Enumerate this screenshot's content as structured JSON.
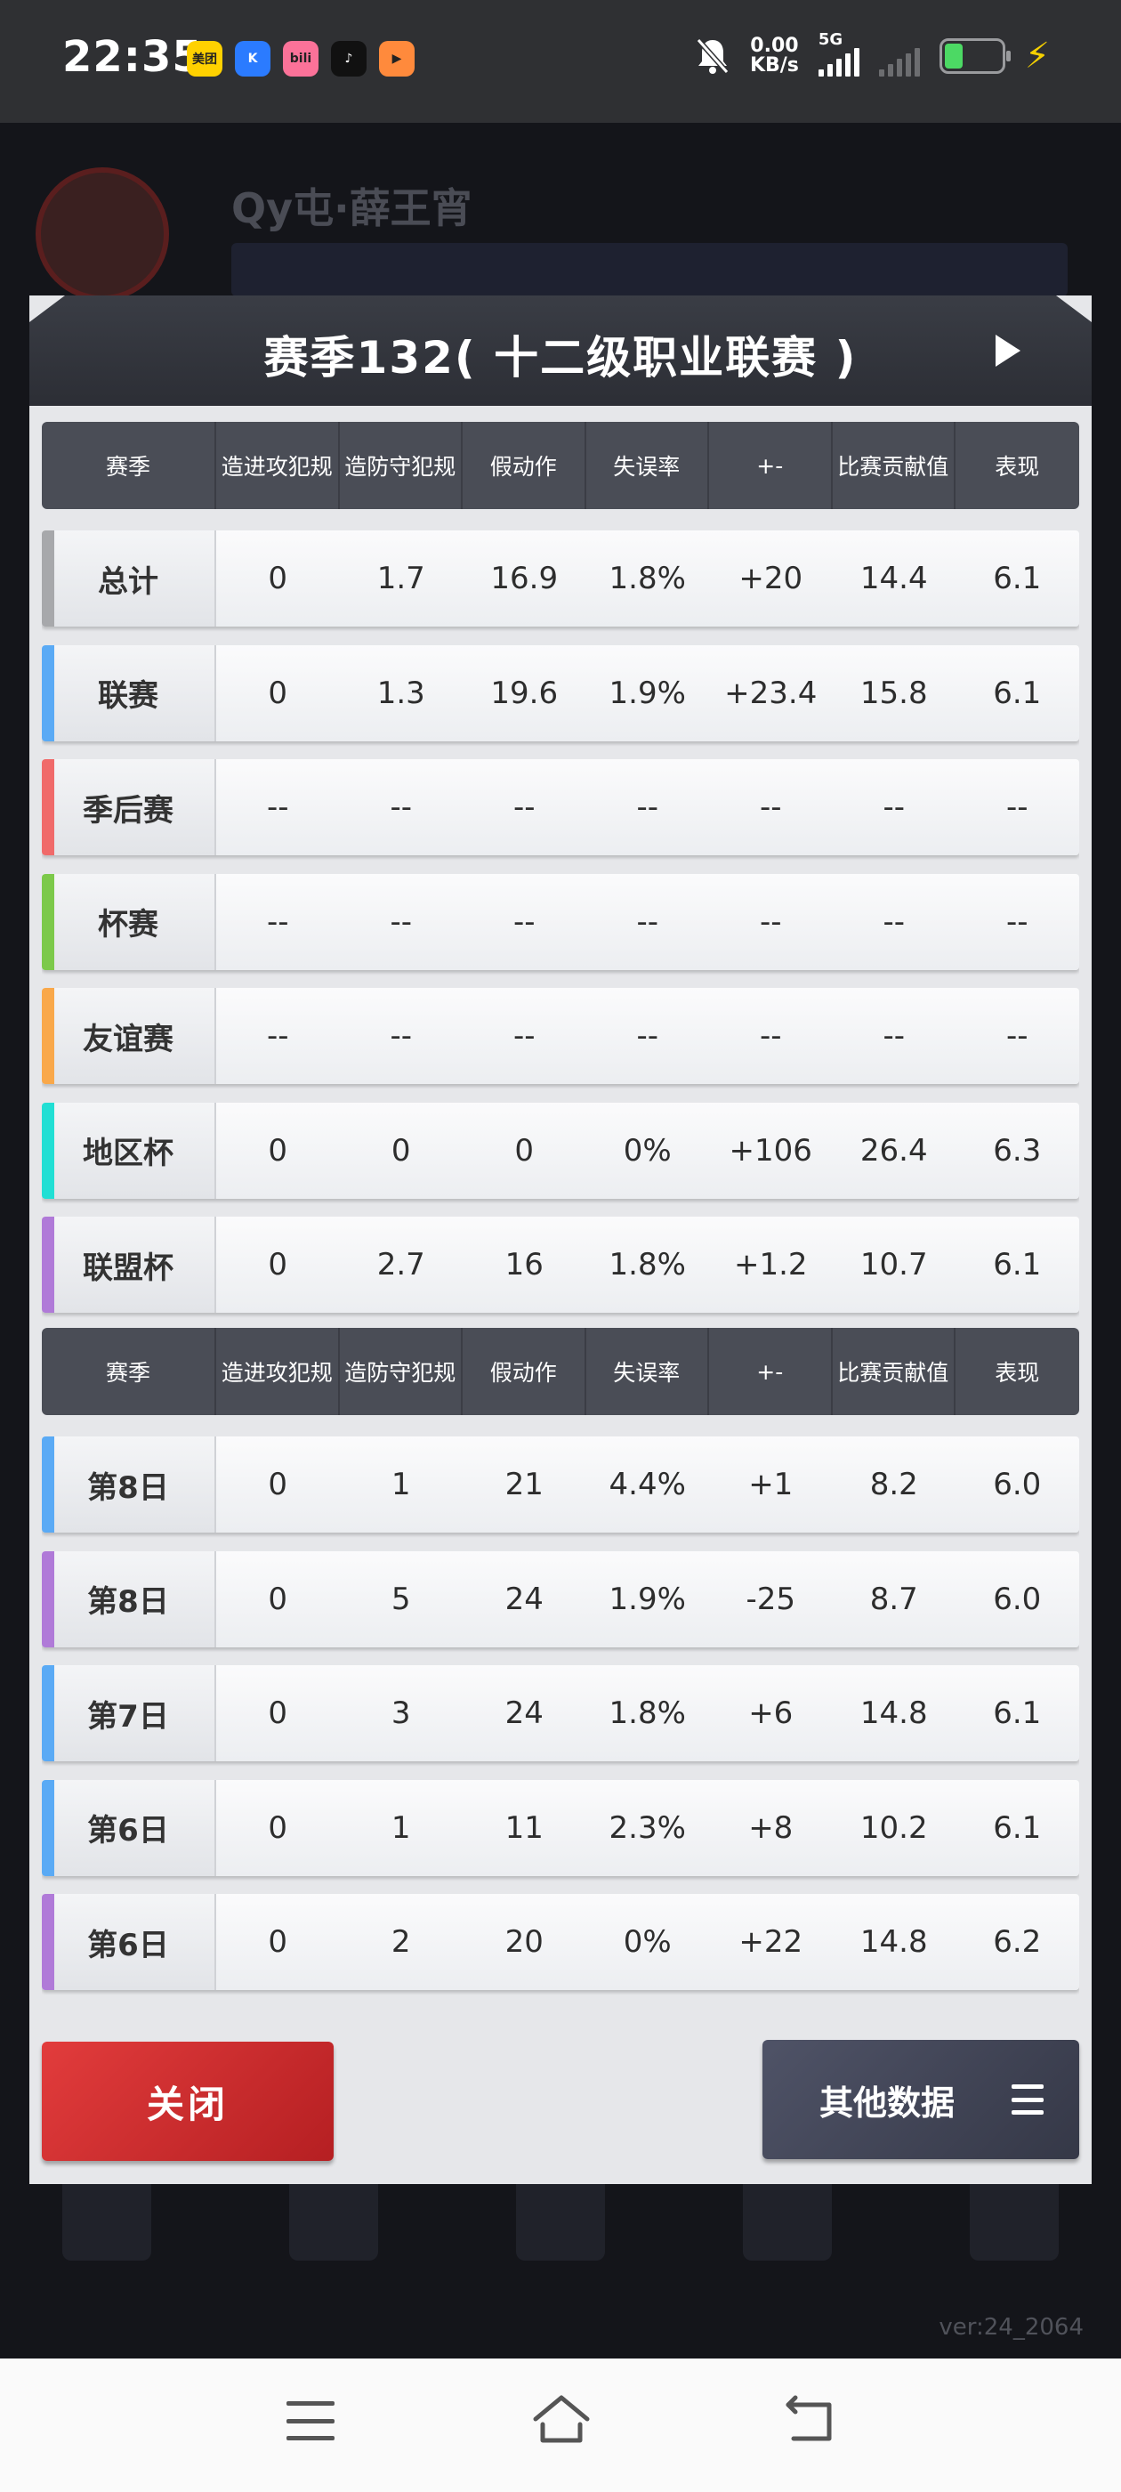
{
  "status_bar": {
    "time": "22:35",
    "apps": [
      {
        "label": "美团",
        "color": "#ffd100",
        "icon": "meituan-icon"
      },
      {
        "label": "K",
        "color": "#2b7bff",
        "icon": "kugou-icon"
      },
      {
        "label": "bili",
        "color": "#fb7299",
        "icon": "bilibili-icon"
      },
      {
        "label": "♪",
        "color": "#111111",
        "icon": "tiktok-icon"
      },
      {
        "label": "▶",
        "color": "#ff8a3c",
        "icon": "video-icon"
      }
    ],
    "speed_value": "0.00",
    "speed_unit": "KB/s",
    "network": "5G",
    "icons": [
      "mute-icon",
      "signal-icon",
      "battery-icon",
      "charging-icon"
    ]
  },
  "modal": {
    "title": "赛季132( 十二级职业联赛 )",
    "columns": [
      "赛季",
      "造进攻犯规",
      "造防守犯规",
      "假动作",
      "失误率",
      "+-",
      "比赛贡献值",
      "表现"
    ],
    "summary_rows": [
      {
        "label": "总计",
        "accent": "#a7a8ab",
        "values": [
          "0",
          "1.7",
          "16.9",
          "1.8%",
          "+20",
          "14.4",
          "6.1"
        ]
      },
      {
        "label": "联赛",
        "accent": "#5aaaf5",
        "values": [
          "0",
          "1.3",
          "19.6",
          "1.9%",
          "+23.4",
          "15.8",
          "6.1"
        ]
      },
      {
        "label": "季后赛",
        "accent": "#f06a6a",
        "values": [
          "--",
          "--",
          "--",
          "--",
          "--",
          "--",
          "--"
        ]
      },
      {
        "label": "杯赛",
        "accent": "#7cc94a",
        "values": [
          "--",
          "--",
          "--",
          "--",
          "--",
          "--",
          "--"
        ]
      },
      {
        "label": "友谊赛",
        "accent": "#f9a84a",
        "values": [
          "--",
          "--",
          "--",
          "--",
          "--",
          "--",
          "--"
        ]
      },
      {
        "label": "地区杯",
        "accent": "#21dfd4",
        "values": [
          "0",
          "0",
          "0",
          "0%",
          "+106",
          "26.4",
          "6.3"
        ]
      },
      {
        "label": "联盟杯",
        "accent": "#b07ad8",
        "values": [
          "0",
          "2.7",
          "16",
          "1.8%",
          "+1.2",
          "10.7",
          "6.1"
        ]
      }
    ],
    "game_rows": [
      {
        "label": "第8日",
        "accent": "#5aaaf5",
        "values": [
          "0",
          "1",
          "21",
          "4.4%",
          "+1",
          "8.2",
          "6.0"
        ]
      },
      {
        "label": "第8日",
        "accent": "#b07ad8",
        "values": [
          "0",
          "5",
          "24",
          "1.9%",
          "-25",
          "8.7",
          "6.0"
        ]
      },
      {
        "label": "第7日",
        "accent": "#5aaaf5",
        "values": [
          "0",
          "3",
          "24",
          "1.8%",
          "+6",
          "14.8",
          "6.1"
        ]
      },
      {
        "label": "第6日",
        "accent": "#5aaaf5",
        "values": [
          "0",
          "1",
          "11",
          "2.3%",
          "+8",
          "10.2",
          "6.1"
        ]
      },
      {
        "label": "第6日",
        "accent": "#b07ad8",
        "values": [
          "0",
          "2",
          "20",
          "0%",
          "+22",
          "14.8",
          "6.2"
        ]
      },
      {
        "label": "",
        "accent": "#5aaaf5",
        "values": [
          "",
          "",
          "",
          "",
          "",
          "",
          ""
        ]
      }
    ],
    "close_label": "关闭",
    "other_label": "其他数据"
  },
  "background": {
    "player_name": "Qy屯·薛王宵",
    "version": "ver:24_2064"
  },
  "nav_icons": [
    "menu-icon",
    "home-icon",
    "back-icon"
  ]
}
